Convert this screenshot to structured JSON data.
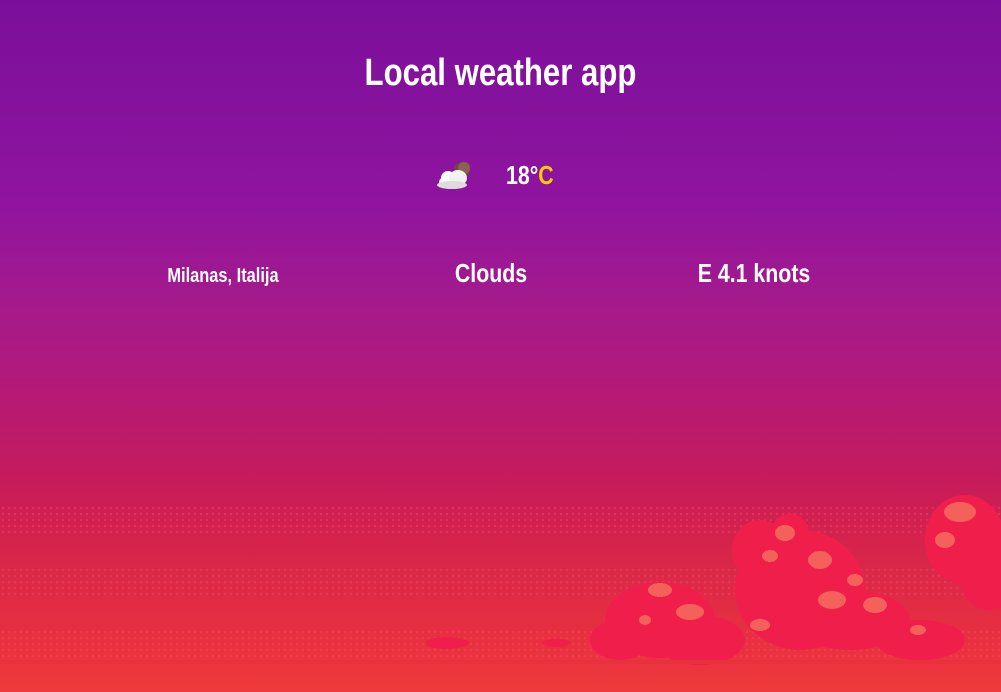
{
  "app": {
    "title": "Local weather app"
  },
  "current": {
    "icon": "cloud-moon-icon",
    "temperature": "18°",
    "unit": "C",
    "unit_color": "#ffcc00"
  },
  "details": {
    "location": "Milanas, Italija",
    "description": "Clouds",
    "wind": "E 4.1 knots"
  },
  "colors": {
    "top": "#7b0f9b",
    "bottom": "#ef3a3d",
    "cloud": "#f01e4b",
    "cloud_highlight": "#f4605a"
  }
}
